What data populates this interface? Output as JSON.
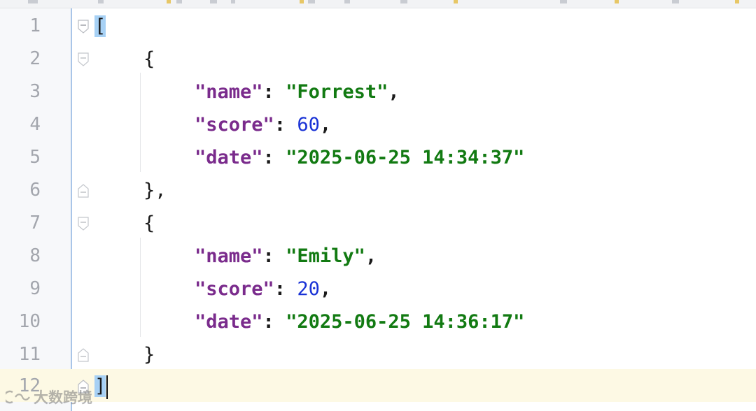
{
  "editor": {
    "colors": {
      "key": "#7a2b8c",
      "string": "#127a12",
      "number": "#1a33d6",
      "punctuation": "#1a1a1a",
      "line_number": "#a3a6ad",
      "current_line_bg": "#fdf9e4",
      "bracket_match_bg": "#a7d1f5"
    },
    "lines": [
      {
        "number": "1",
        "open": "[",
        "close": ""
      },
      {
        "number": "2",
        "open": "{",
        "close": ""
      },
      {
        "number": "3",
        "key": "\"name\"",
        "sep": ": ",
        "value": "\"Forrest\"",
        "trail": ","
      },
      {
        "number": "4",
        "key": "\"score\"",
        "sep": ": ",
        "value": "60",
        "trail": ","
      },
      {
        "number": "5",
        "key": "\"date\"",
        "sep": ": ",
        "value": "\"2025-06-25 14:34:37\"",
        "trail": ""
      },
      {
        "number": "6",
        "open": "},",
        "close": ""
      },
      {
        "number": "7",
        "open": "{",
        "close": ""
      },
      {
        "number": "8",
        "key": "\"name\"",
        "sep": ": ",
        "value": "\"Emily\"",
        "trail": ","
      },
      {
        "number": "9",
        "key": "\"score\"",
        "sep": ": ",
        "value": "20",
        "trail": ","
      },
      {
        "number": "10",
        "key": "\"date\"",
        "sep": ": ",
        "value": "\"2025-06-25 14:36:17\"",
        "trail": ""
      },
      {
        "number": "11",
        "open": "}",
        "close": ""
      },
      {
        "number": "12",
        "open": "]",
        "close": ""
      }
    ],
    "fold_icons": [
      "fold-open-icon",
      "fold-close-icon"
    ]
  },
  "watermark": {
    "text": "大数跨境",
    "icon": "watermark-logo-icon"
  }
}
